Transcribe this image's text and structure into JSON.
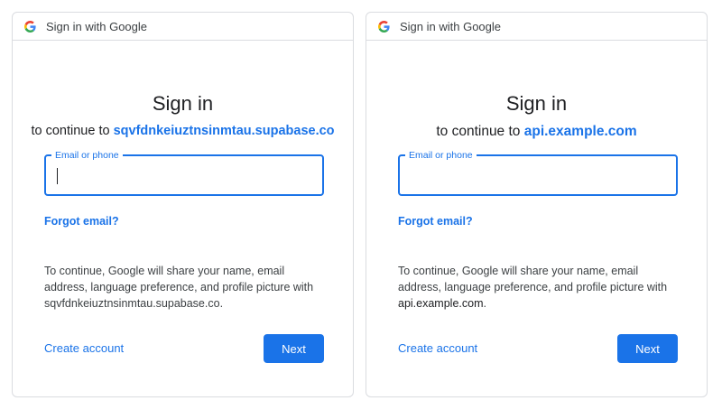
{
  "windows": [
    {
      "title": "Sign in with Google",
      "heading": "Sign in",
      "subtitle_prefix": "to continue to",
      "domain": "sqvfdnkeiuztnsinmtau.supabase.co",
      "field_label": "Email or phone",
      "forgot_email": "Forgot email?",
      "info_text": "To continue, Google will share your name, email address, language preference, and profile picture with",
      "info_domain": "sqvfdnkeiuztnsinmtau.supabase.co",
      "info_suffix": ".",
      "create_account": "Create account",
      "next": "Next"
    },
    {
      "title": "Sign in with Google",
      "heading": "Sign in",
      "subtitle_prefix": "to continue to",
      "domain": "api.example.com",
      "field_label": "Email or phone",
      "forgot_email": "Forgot email?",
      "info_text": "To continue, Google will share your name, email address, language preference, and profile picture with",
      "info_domain": "api.example.com",
      "info_suffix": ".",
      "create_account": "Create account",
      "next": "Next"
    }
  ],
  "colors": {
    "accent": "#1a73e8",
    "text": "#202124",
    "border": "#dadce0"
  },
  "icons": [
    "google-logo-icon"
  ]
}
